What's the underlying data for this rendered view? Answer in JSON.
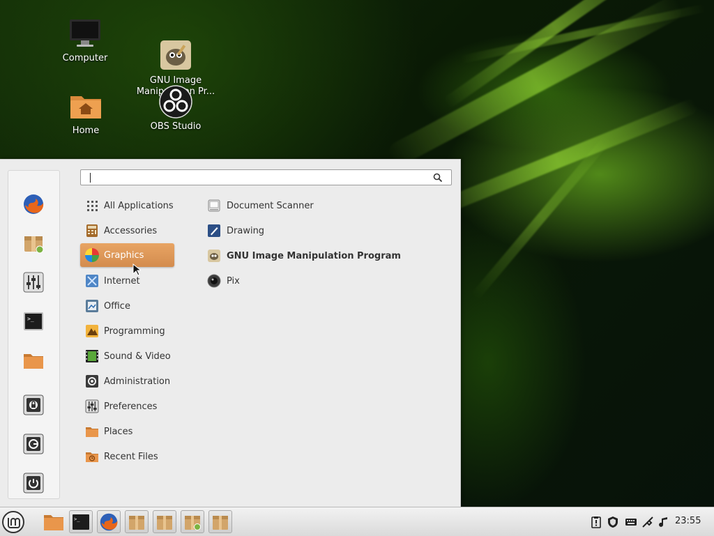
{
  "desktop": {
    "icons": [
      {
        "label": "Computer",
        "icon": "computer-icon"
      },
      {
        "label": "GNU Image\nManipulation Pr...",
        "icon": "gimp-icon"
      },
      {
        "label": "Home",
        "icon": "home-folder-icon"
      },
      {
        "label": "OBS Studio",
        "icon": "obs-icon"
      }
    ]
  },
  "menu": {
    "search": {
      "value": "",
      "placeholder": "",
      "icon": "search-icon"
    },
    "favorites": [
      {
        "name": "Firefox",
        "icon": "firefox-icon"
      },
      {
        "name": "Software Manager",
        "icon": "software-manager-icon"
      },
      {
        "name": "System Settings",
        "icon": "settings-sliders-icon"
      },
      {
        "name": "Terminal",
        "icon": "terminal-icon"
      },
      {
        "name": "Files",
        "icon": "folder-icon"
      },
      {
        "name": "Lock Screen",
        "icon": "lock-icon"
      },
      {
        "name": "Log Out",
        "icon": "logout-icon"
      },
      {
        "name": "Quit",
        "icon": "power-icon"
      }
    ],
    "categories": [
      {
        "label": "All Applications",
        "icon": "grid-icon"
      },
      {
        "label": "Accessories",
        "icon": "calculator-icon"
      },
      {
        "label": "Graphics",
        "icon": "graphics-icon",
        "selected": true
      },
      {
        "label": "Internet",
        "icon": "internet-icon"
      },
      {
        "label": "Office",
        "icon": "office-icon"
      },
      {
        "label": "Programming",
        "icon": "programming-icon"
      },
      {
        "label": "Sound & Video",
        "icon": "sound-video-icon"
      },
      {
        "label": "Administration",
        "icon": "administration-icon"
      },
      {
        "label": "Preferences",
        "icon": "preferences-icon"
      },
      {
        "label": "Places",
        "icon": "places-folder-icon"
      },
      {
        "label": "Recent Files",
        "icon": "recent-files-icon"
      }
    ],
    "apps": [
      {
        "label": "Document Scanner",
        "icon": "scanner-icon"
      },
      {
        "label": "Drawing",
        "icon": "drawing-icon"
      },
      {
        "label": "GNU Image Manipulation Program",
        "icon": "gimp-icon"
      },
      {
        "label": "Pix",
        "icon": "pix-icon"
      }
    ]
  },
  "panel": {
    "menu_button": "mint-menu-icon",
    "launchers": [
      "folder-icon",
      "terminal-icon",
      "firefox-icon",
      "package-icon",
      "package-icon",
      "software-manager-icon",
      "package-icon"
    ],
    "tray": [
      "clipboard-icon",
      "shield-icon",
      "keyboard-icon",
      "network-icon",
      "music-note-icon"
    ],
    "clock": "23:55"
  },
  "colors": {
    "selected_category": "#dd975a",
    "menu_bg": "#ececec",
    "panel_bg": "#e4e4e4"
  }
}
